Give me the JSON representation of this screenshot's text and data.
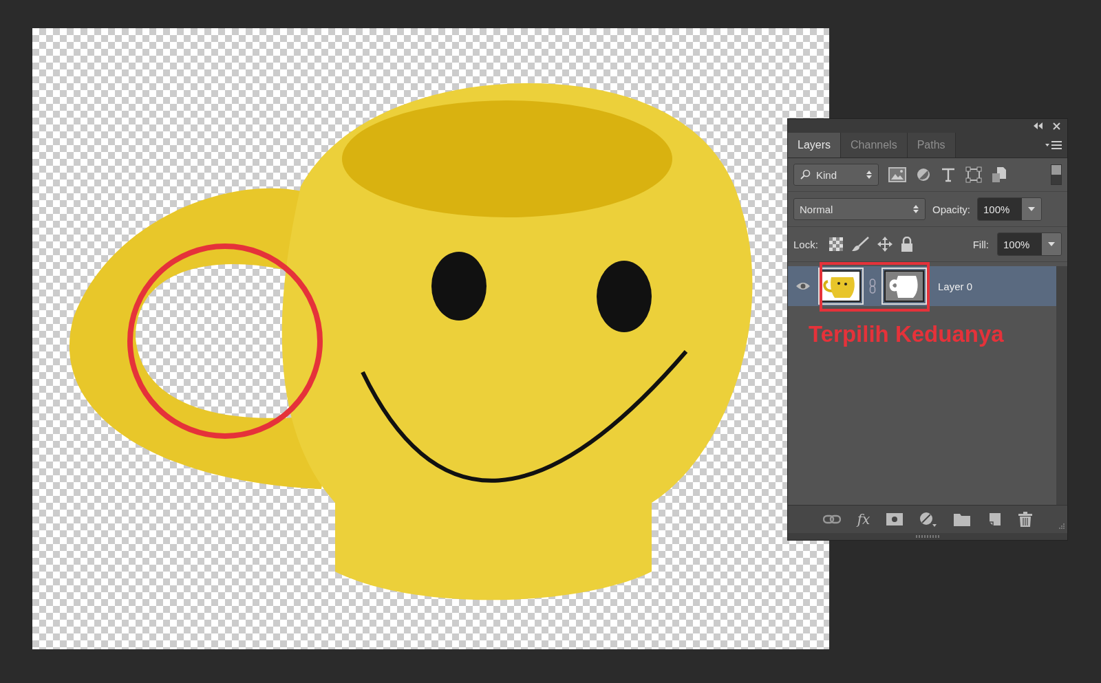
{
  "panel": {
    "tabs": [
      {
        "label": "Layers",
        "selected": true
      },
      {
        "label": "Channels",
        "selected": false
      },
      {
        "label": "Paths",
        "selected": false
      }
    ],
    "filter": {
      "value": "Kind"
    },
    "blend_mode": {
      "value": "Normal"
    },
    "opacity": {
      "label": "Opacity:",
      "value": "100%"
    },
    "lock": {
      "label": "Lock:"
    },
    "fill": {
      "label": "Fill:",
      "value": "100%"
    },
    "layers": [
      {
        "name": "Layer 0",
        "visible": true,
        "selected": true,
        "linked": true
      }
    ],
    "fx_label": "fx"
  },
  "annotation": {
    "text": "Terpilih Keduanya"
  }
}
